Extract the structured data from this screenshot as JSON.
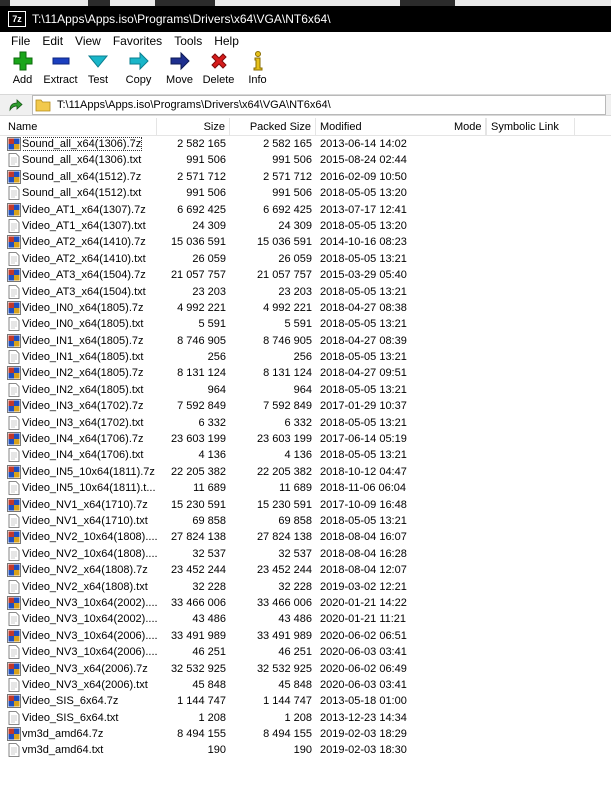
{
  "window": {
    "title": "T:\\11Apps\\Apps.iso\\Programs\\Drivers\\x64\\VGA\\NT6x64\\",
    "app_icon_text": "7z"
  },
  "menu": [
    "File",
    "Edit",
    "View",
    "Favorites",
    "Tools",
    "Help"
  ],
  "toolbar": {
    "add": "Add",
    "extract": "Extract",
    "test": "Test",
    "copy": "Copy",
    "move": "Move",
    "delete": "Delete",
    "info": "Info"
  },
  "address": {
    "path": "T:\\11Apps\\Apps.iso\\Programs\\Drivers\\x64\\VGA\\NT6x64\\"
  },
  "columns": {
    "name": "Name",
    "size": "Size",
    "packed": "Packed Size",
    "modified": "Modified",
    "mode": "Mode",
    "symlink": "Symbolic Link"
  },
  "colors": {
    "titlebar": "#000000",
    "archive_icon_red": "#c0392b",
    "archive_icon_blue": "#1f4fbf",
    "add_green": "#1aa51a",
    "extract_blue": "#1b3fbf",
    "test_cyan": "#19b6c9",
    "move_navy": "#1e2f8f",
    "delete_red": "#d61c1c",
    "info_yellow": "#e7c21b"
  },
  "files": [
    {
      "name": "Sound_all_x64(1306).7z",
      "size": "2 582 165",
      "packed": "2 582 165",
      "modified": "2013-06-14 14:02",
      "type": "archive"
    },
    {
      "name": "Sound_all_x64(1306).txt",
      "size": "991 506",
      "packed": "991 506",
      "modified": "2015-08-24 02:44",
      "type": "text"
    },
    {
      "name": "Sound_all_x64(1512).7z",
      "size": "2 571 712",
      "packed": "2 571 712",
      "modified": "2016-02-09 10:50",
      "type": "archive"
    },
    {
      "name": "Sound_all_x64(1512).txt",
      "size": "991 506",
      "packed": "991 506",
      "modified": "2018-05-05 13:20",
      "type": "text"
    },
    {
      "name": "Video_AT1_x64(1307).7z",
      "size": "6 692 425",
      "packed": "6 692 425",
      "modified": "2013-07-17 12:41",
      "type": "archive"
    },
    {
      "name": "Video_AT1_x64(1307).txt",
      "size": "24 309",
      "packed": "24 309",
      "modified": "2018-05-05 13:20",
      "type": "text"
    },
    {
      "name": "Video_AT2_x64(1410).7z",
      "size": "15 036 591",
      "packed": "15 036 591",
      "modified": "2014-10-16 08:23",
      "type": "archive"
    },
    {
      "name": "Video_AT2_x64(1410).txt",
      "size": "26 059",
      "packed": "26 059",
      "modified": "2018-05-05 13:21",
      "type": "text"
    },
    {
      "name": "Video_AT3_x64(1504).7z",
      "size": "21 057 757",
      "packed": "21 057 757",
      "modified": "2015-03-29 05:40",
      "type": "archive"
    },
    {
      "name": "Video_AT3_x64(1504).txt",
      "size": "23 203",
      "packed": "23 203",
      "modified": "2018-05-05 13:21",
      "type": "text"
    },
    {
      "name": "Video_IN0_x64(1805).7z",
      "size": "4 992 221",
      "packed": "4 992 221",
      "modified": "2018-04-27 08:38",
      "type": "archive"
    },
    {
      "name": "Video_IN0_x64(1805).txt",
      "size": "5 591",
      "packed": "5 591",
      "modified": "2018-05-05 13:21",
      "type": "text"
    },
    {
      "name": "Video_IN1_x64(1805).7z",
      "size": "8 746 905",
      "packed": "8 746 905",
      "modified": "2018-04-27 08:39",
      "type": "archive"
    },
    {
      "name": "Video_IN1_x64(1805).txt",
      "size": "256",
      "packed": "256",
      "modified": "2018-05-05 13:21",
      "type": "text"
    },
    {
      "name": "Video_IN2_x64(1805).7z",
      "size": "8 131 124",
      "packed": "8 131 124",
      "modified": "2018-04-27 09:51",
      "type": "archive"
    },
    {
      "name": "Video_IN2_x64(1805).txt",
      "size": "964",
      "packed": "964",
      "modified": "2018-05-05 13:21",
      "type": "text"
    },
    {
      "name": "Video_IN3_x64(1702).7z",
      "size": "7 592 849",
      "packed": "7 592 849",
      "modified": "2017-01-29 10:37",
      "type": "archive"
    },
    {
      "name": "Video_IN3_x64(1702).txt",
      "size": "6 332",
      "packed": "6 332",
      "modified": "2018-05-05 13:21",
      "type": "text"
    },
    {
      "name": "Video_IN4_x64(1706).7z",
      "size": "23 603 199",
      "packed": "23 603 199",
      "modified": "2017-06-14 05:19",
      "type": "archive"
    },
    {
      "name": "Video_IN4_x64(1706).txt",
      "size": "4 136",
      "packed": "4 136",
      "modified": "2018-05-05 13:21",
      "type": "text"
    },
    {
      "name": "Video_IN5_10x64(1811).7z",
      "size": "22 205 382",
      "packed": "22 205 382",
      "modified": "2018-10-12 04:47",
      "type": "archive"
    },
    {
      "name": "Video_IN5_10x64(1811).t...",
      "size": "11 689",
      "packed": "11 689",
      "modified": "2018-11-06 06:04",
      "type": "text"
    },
    {
      "name": "Video_NV1_x64(1710).7z",
      "size": "15 230 591",
      "packed": "15 230 591",
      "modified": "2017-10-09 16:48",
      "type": "archive"
    },
    {
      "name": "Video_NV1_x64(1710).txt",
      "size": "69 858",
      "packed": "69 858",
      "modified": "2018-05-05 13:21",
      "type": "text"
    },
    {
      "name": "Video_NV2_10x64(1808)....",
      "size": "27 824 138",
      "packed": "27 824 138",
      "modified": "2018-08-04 16:07",
      "type": "archive"
    },
    {
      "name": "Video_NV2_10x64(1808)....",
      "size": "32 537",
      "packed": "32 537",
      "modified": "2018-08-04 16:28",
      "type": "text"
    },
    {
      "name": "Video_NV2_x64(1808).7z",
      "size": "23 452 244",
      "packed": "23 452 244",
      "modified": "2018-08-04 12:07",
      "type": "archive"
    },
    {
      "name": "Video_NV2_x64(1808).txt",
      "size": "32 228",
      "packed": "32 228",
      "modified": "2019-03-02 12:21",
      "type": "text"
    },
    {
      "name": "Video_NV3_10x64(2002)....",
      "size": "33 466 006",
      "packed": "33 466 006",
      "modified": "2020-01-21 14:22",
      "type": "archive"
    },
    {
      "name": "Video_NV3_10x64(2002)....",
      "size": "43 486",
      "packed": "43 486",
      "modified": "2020-01-21 11:21",
      "type": "text"
    },
    {
      "name": "Video_NV3_10x64(2006)....",
      "size": "33 491 989",
      "packed": "33 491 989",
      "modified": "2020-06-02 06:51",
      "type": "archive"
    },
    {
      "name": "Video_NV3_10x64(2006)....",
      "size": "46 251",
      "packed": "46 251",
      "modified": "2020-06-03 03:41",
      "type": "text"
    },
    {
      "name": "Video_NV3_x64(2006).7z",
      "size": "32 532 925",
      "packed": "32 532 925",
      "modified": "2020-06-02 06:49",
      "type": "archive"
    },
    {
      "name": "Video_NV3_x64(2006).txt",
      "size": "45 848",
      "packed": "45 848",
      "modified": "2020-06-03 03:41",
      "type": "text"
    },
    {
      "name": "Video_SIS_6x64.7z",
      "size": "1 144 747",
      "packed": "1 144 747",
      "modified": "2013-05-18 01:00",
      "type": "archive"
    },
    {
      "name": "Video_SIS_6x64.txt",
      "size": "1 208",
      "packed": "1 208",
      "modified": "2013-12-23 14:34",
      "type": "text"
    },
    {
      "name": "vm3d_amd64.7z",
      "size": "8 494 155",
      "packed": "8 494 155",
      "modified": "2019-02-03 18:29",
      "type": "archive"
    },
    {
      "name": "vm3d_amd64.txt",
      "size": "190",
      "packed": "190",
      "modified": "2019-02-03 18:30",
      "type": "text"
    }
  ]
}
